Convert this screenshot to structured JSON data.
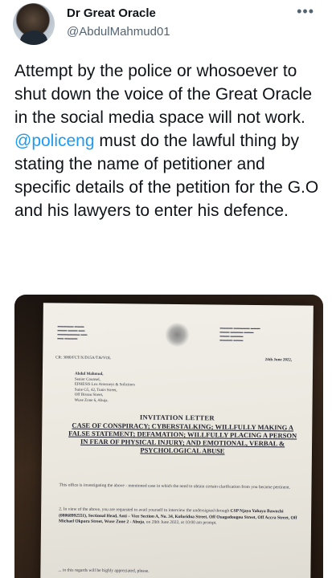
{
  "header": {
    "display_name": "Dr Great Oracle",
    "handle": "@AbdulMahmud01",
    "more_icon": "ellipsis-icon"
  },
  "tweet": {
    "text_before": "Attempt by the police or whosoever to shut down the voice of the Great Oracle in the social media space will not work. ",
    "mention": "@policeng",
    "text_after": " must do the lawful thing by stating the name of petitioner and specific details of the petition for the G.O and his lawyers to enter his defence."
  },
  "colors": {
    "mention": "#1d9bf0",
    "secondary_text": "#536471",
    "primary_text": "#0f1419"
  },
  "document": {
    "ref": "CR: 3000/FCT/X/D15A/TJ6/VOL",
    "date": "24th June 2022,",
    "recipient": [
      "Abdul Mahmud,",
      "Senior Counsel,",
      "EPHESIS Lex Attorneys & Solicitors",
      "Suite G5, 42, Tunis Street,",
      "Off Bissau Street,",
      "Wuse Zone 6, Abuja."
    ],
    "title": "INVITATION LETTER",
    "case": "CASE OF CONSPIRACY; CYBERSTALKING; WILLFULLY MAKING A FALSE STATEMENT; DEFAMATION; WILLFULLY PLACING A PERSON IN FEAR OF PHYSICAL INJURY; AND EMOTIONAL, VERBAL & PSYCHOLOGICAL ABUSE",
    "para1": "This office is investigating the above - mentioned case in which the need to obtain certain clarification from you became pertinent.",
    "para2_lead": "2. In view of the above, you are requested to avail yourself to interview the undersigned through ",
    "para2_bold": "CSP Njayo Yahaya Bawuchi (08068992551), Sectional Head, Anti – Vice Section A, No. 34, Koforidua Street, Off Ouagadougou Street, Off Accra Street, Off Michael Okpara Street, Wuse Zone 2 - Abuja",
    "para2_end": ", on 28th June 2022, at 10:00 am prompt.",
    "para3": "... in this regards will be highly appreciated, please."
  }
}
